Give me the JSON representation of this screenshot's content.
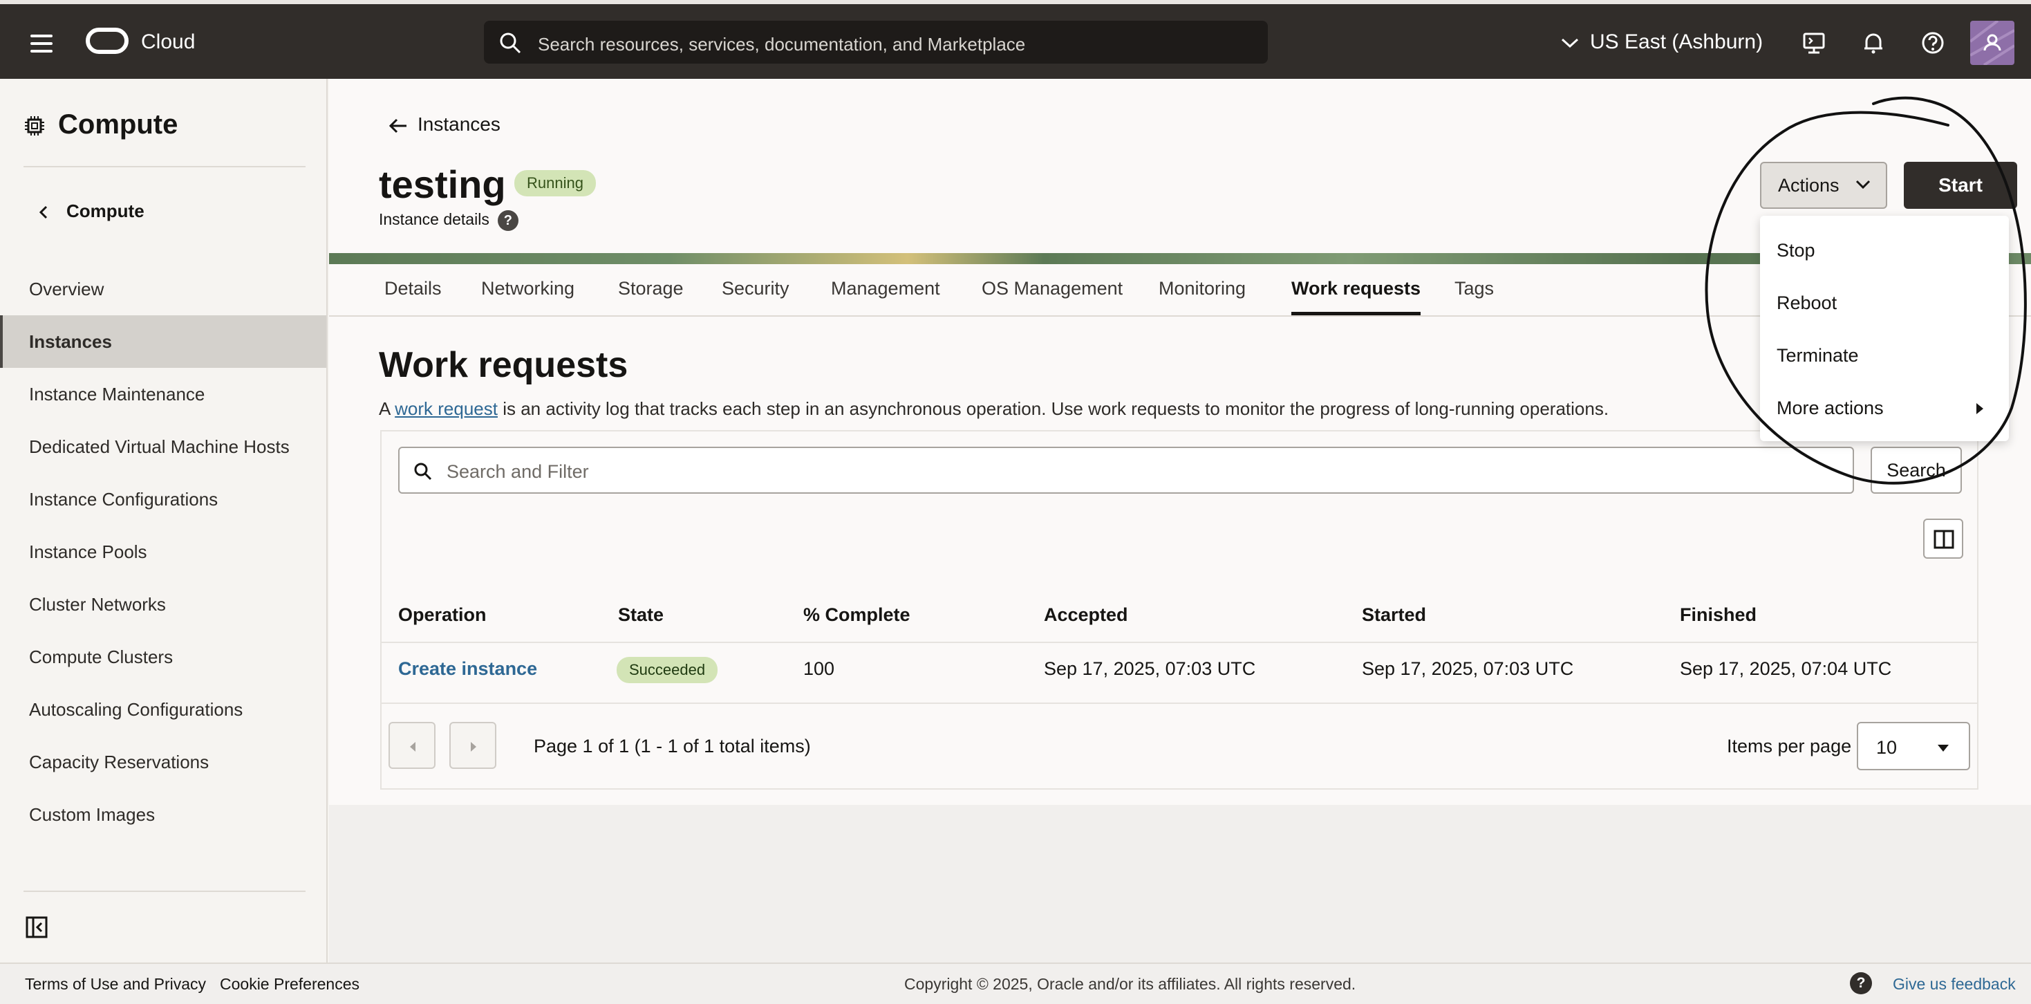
{
  "topbar": {
    "brand": "Cloud",
    "search_placeholder": "Search resources, services, documentation, and Marketplace",
    "region": "US East (Ashburn)"
  },
  "sidebar": {
    "title": "Compute",
    "back_label": "Compute",
    "items": [
      {
        "label": "Overview"
      },
      {
        "label": "Instances"
      },
      {
        "label": "Instance Maintenance"
      },
      {
        "label": "Dedicated Virtual Machine Hosts"
      },
      {
        "label": "Instance Configurations"
      },
      {
        "label": "Instance Pools"
      },
      {
        "label": "Cluster Networks"
      },
      {
        "label": "Compute Clusters"
      },
      {
        "label": "Autoscaling Configurations"
      },
      {
        "label": "Capacity Reservations"
      },
      {
        "label": "Custom Images"
      }
    ],
    "active_item": "Instances"
  },
  "header": {
    "back_link": "Instances",
    "title": "testing",
    "status": "Running",
    "subtitle": "Instance details",
    "help": "?",
    "actions_label": "Actions",
    "start_label": "Start"
  },
  "actions_menu": {
    "items": [
      {
        "label": "Stop"
      },
      {
        "label": "Reboot"
      },
      {
        "label": "Terminate"
      },
      {
        "label": "More actions"
      }
    ]
  },
  "tabs": [
    {
      "label": "Details"
    },
    {
      "label": "Networking"
    },
    {
      "label": "Storage"
    },
    {
      "label": "Security"
    },
    {
      "label": "Management"
    },
    {
      "label": "OS Management"
    },
    {
      "label": "Monitoring"
    },
    {
      "label": "Work requests"
    },
    {
      "label": "Tags"
    }
  ],
  "active_tab": "Work requests",
  "section": {
    "title": "Work requests",
    "desc_prefix": "A ",
    "desc_link": "work request",
    "desc_suffix": " is an activity log that tracks each step in an asynchronous operation. Use work requests to monitor the progress of long-running operations."
  },
  "filter": {
    "placeholder": "Search and Filter",
    "search_button": "Search"
  },
  "table": {
    "columns": [
      "Operation",
      "State",
      "% Complete",
      "Accepted",
      "Started",
      "Finished"
    ],
    "rows": [
      {
        "operation": "Create instance",
        "state": "Succeeded",
        "complete": "100",
        "accepted": "Sep 17, 2025, 07:03 UTC",
        "started": "Sep 17, 2025, 07:03 UTC",
        "finished": "Sep 17, 2025, 07:04 UTC"
      }
    ]
  },
  "pagination": {
    "text": "Page 1 of 1 (1 - 1 of 1 total items)",
    "items_per_page_label": "Items per page",
    "items_per_page": "10"
  },
  "footer": {
    "terms": "Terms of Use and Privacy",
    "cookies": "Cookie Preferences",
    "copyright": "Copyright © 2025, Oracle and/or its affiliates. All rights reserved.",
    "help": "?",
    "feedback": "Give us feedback"
  },
  "colors": {
    "topbar": "#312d2a",
    "link": "#2e6894",
    "success_badge": "#d3e4b6"
  }
}
